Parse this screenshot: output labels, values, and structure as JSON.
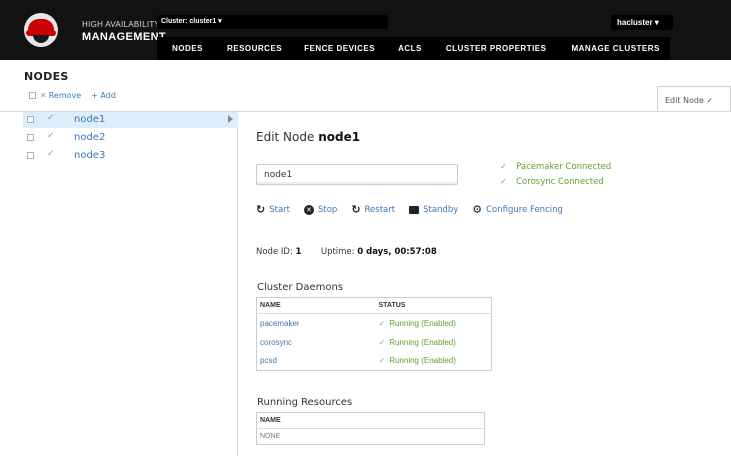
{
  "header": {
    "brand_line1": "HIGH AVAILABILITY",
    "brand_line2": "MANAGEMENT",
    "cluster_selector": "Cluster: cluster1 ▾",
    "user_menu": "hacluster ▾",
    "nav": [
      "NODES",
      "RESOURCES",
      "FENCE DEVICES",
      "ACLS",
      "CLUSTER PROPERTIES",
      "MANAGE CLUSTERS"
    ]
  },
  "page": {
    "title": "NODES",
    "remove_label": "Remove",
    "add_label": "+ Add",
    "tab_label": "Edit Node ✓"
  },
  "nodes": [
    {
      "name": "node1",
      "selected": true
    },
    {
      "name": "node2",
      "selected": false
    },
    {
      "name": "node3",
      "selected": false
    }
  ],
  "detail": {
    "title_prefix": "Edit Node",
    "title_node": "node1",
    "name_value": "node1",
    "connections": [
      "Pacemaker Connected",
      "Corosync Connected"
    ],
    "actions": [
      "Start",
      "Stop",
      "Restart",
      "Standby",
      "Configure Fencing"
    ],
    "node_id_label": "Node ID:",
    "node_id": "1",
    "uptime_label": "Uptime:",
    "uptime": "0 days, 00:57:08",
    "cluster_daemons_title": "Cluster Daemons",
    "daemon_headers": [
      "NAME",
      "STATUS"
    ],
    "daemons": [
      {
        "name": "pacemaker",
        "status": "Running (Enabled)"
      },
      {
        "name": "corosync",
        "status": "Running (Enabled)"
      },
      {
        "name": "pcsd",
        "status": "Running (Enabled)"
      }
    ],
    "running_resources_title": "Running Resources",
    "resources_header": "NAME",
    "resources": [
      "NONE"
    ]
  },
  "colors": {
    "link": "#3b77b5",
    "ok": "#5fa22d",
    "topbar": "#121212",
    "selected_row": "#dceefc"
  }
}
